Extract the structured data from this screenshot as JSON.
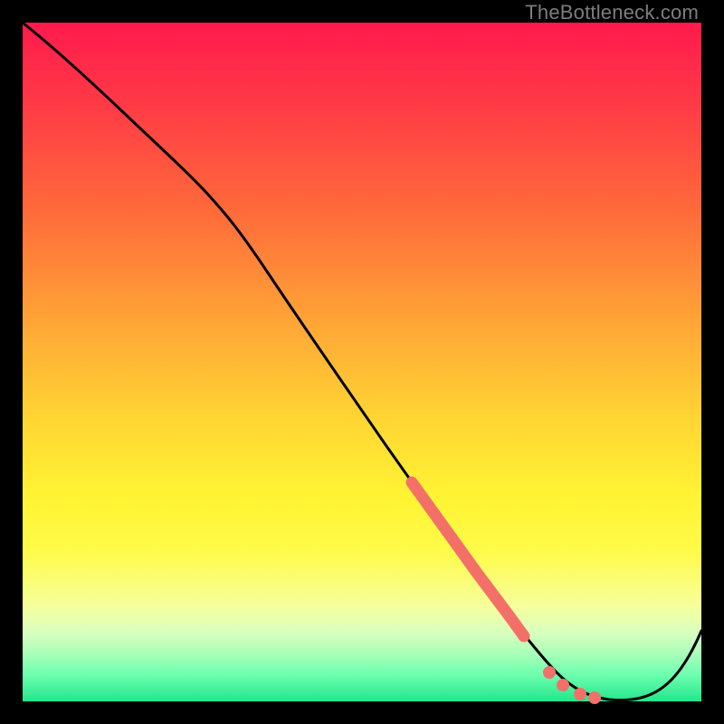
{
  "watermark": "TheBottleneck.com",
  "colors": {
    "frame": "#000000",
    "curve": "#000000",
    "marker": "#f37068",
    "gradient_top": "#ff1a4d",
    "gradient_bottom": "#22e68a"
  },
  "chart_data": {
    "type": "line",
    "title": "",
    "xlabel": "",
    "ylabel": "",
    "xlim": [
      0,
      100
    ],
    "ylim": [
      0,
      100
    ],
    "grid": false,
    "legend": false,
    "series": [
      {
        "name": "bottleneck-curve",
        "x": [
          0,
          6,
          12,
          18,
          24,
          30,
          36,
          42,
          48,
          54,
          60,
          66,
          72,
          78,
          82,
          86,
          90,
          94,
          100
        ],
        "y": [
          100,
          95,
          89,
          83,
          77,
          72,
          62,
          52,
          42,
          32,
          23,
          15,
          8,
          3,
          1,
          0,
          0,
          4,
          12
        ]
      }
    ],
    "highlight_segment": {
      "description": "thick salmon overlay on steep descending portion near bottom",
      "x": [
        56,
        58,
        60,
        62,
        64,
        66,
        68,
        70,
        72,
        74
      ],
      "y": [
        30,
        27,
        23,
        20,
        17,
        15,
        12,
        10,
        8,
        6
      ]
    },
    "markers": [
      {
        "x": 77.5,
        "y": 3.5
      },
      {
        "x": 79.5,
        "y": 2.2
      },
      {
        "x": 82.0,
        "y": 1.2
      },
      {
        "x": 84.0,
        "y": 0.7
      }
    ]
  }
}
